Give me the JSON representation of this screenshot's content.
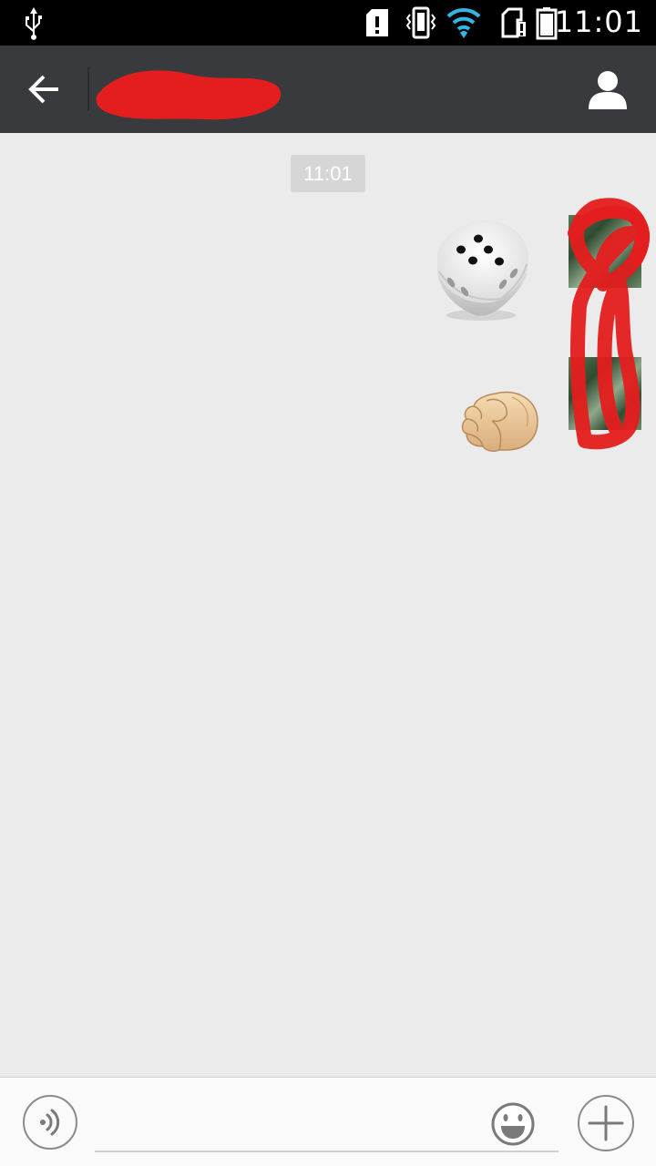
{
  "status_bar": {
    "time": "11:01",
    "icons": [
      "usb-icon",
      "sd-card-alert-icon",
      "vibrate-icon",
      "wifi-icon",
      "sim-alert-icon",
      "battery-icon"
    ],
    "wifi_color": "#33b5e5"
  },
  "header": {
    "contact_name": "",
    "contact_name_redacted": true,
    "background": "#393a3e",
    "icons": [
      "back-arrow-icon",
      "profile-icon"
    ]
  },
  "chat": {
    "time_divider": "11:01",
    "messages": [
      {
        "direction": "outgoing",
        "type": "sticker",
        "sticker": "dice-icon",
        "dice_value": 5
      },
      {
        "direction": "outgoing",
        "type": "sticker",
        "sticker": "fist-emoji-icon"
      }
    ],
    "avatar_redacted": true
  },
  "input_bar": {
    "message_value": "",
    "message_placeholder": "",
    "icons": [
      "voice-icon",
      "emoji-icon",
      "add-icon"
    ]
  }
}
